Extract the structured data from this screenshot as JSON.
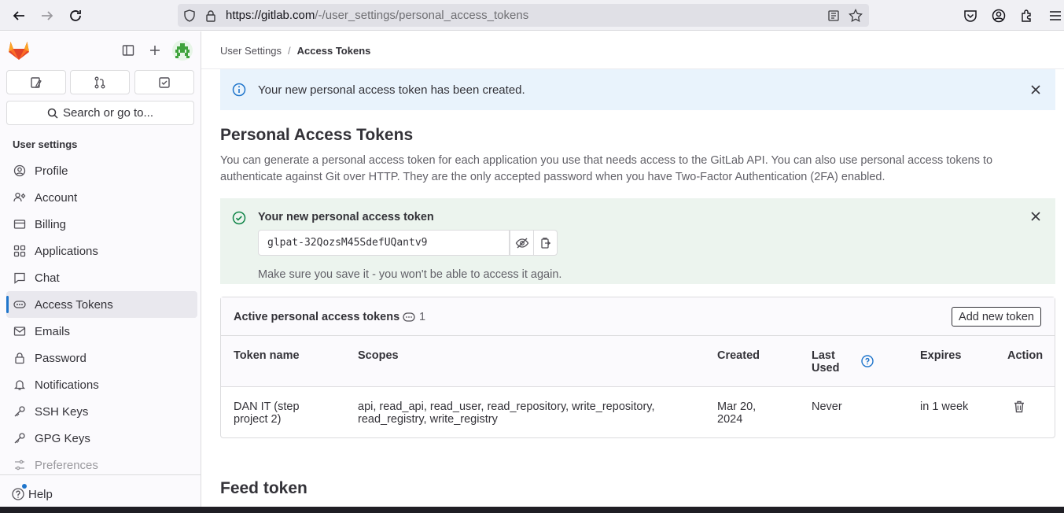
{
  "browser": {
    "url_host": "https://gitlab.com",
    "url_path": "/-/user_settings/personal_access_tokens"
  },
  "sidebar": {
    "search_label": "Search or go to...",
    "heading": "User settings",
    "items": [
      {
        "label": "Profile"
      },
      {
        "label": "Account"
      },
      {
        "label": "Billing"
      },
      {
        "label": "Applications"
      },
      {
        "label": "Chat"
      },
      {
        "label": "Access Tokens"
      },
      {
        "label": "Emails"
      },
      {
        "label": "Password"
      },
      {
        "label": "Notifications"
      },
      {
        "label": "SSH Keys"
      },
      {
        "label": "GPG Keys"
      },
      {
        "label": "Preferences"
      }
    ],
    "help_label": "Help"
  },
  "breadcrumb": {
    "parent": "User Settings",
    "separator": "/",
    "current": "Access Tokens"
  },
  "info_alert": {
    "text": "Your new personal access token has been created."
  },
  "page": {
    "title": "Personal Access Tokens",
    "description": "You can generate a personal access token for each application you use that needs access to the GitLab API. You can also use personal access tokens to authenticate against Git over HTTP. They are the only accepted password when you have Two-Factor Authentication (2FA) enabled."
  },
  "new_token": {
    "title": "Your new personal access token",
    "value": "glpat-32QozsM45SdefUQantv9",
    "note": "Make sure you save it - you won't be able to access it again."
  },
  "active_tokens": {
    "title": "Active personal access tokens",
    "count": "1",
    "add_button": "Add new token",
    "headers": {
      "name": "Token name",
      "scopes": "Scopes",
      "created": "Created",
      "last_used_1": "Last",
      "last_used_2": "Used",
      "expires": "Expires",
      "action": "Action"
    },
    "rows": [
      {
        "name_1": "DAN IT (step",
        "name_2": "project 2)",
        "scopes_1": "api, read_api, read_user, read_repository, write_repository,",
        "scopes_2": "read_registry, write_registry",
        "created_1": "Mar 20,",
        "created_2": "2024",
        "last_used": "Never",
        "expires": "in 1 week"
      }
    ]
  },
  "feed": {
    "title": "Feed token"
  },
  "colors": {
    "info_bg": "#e9f3fc",
    "success_bg": "#ecf4ee",
    "success_icon": "#108548",
    "info_icon": "#1f75cb",
    "active_indicator": "#1f75cb"
  }
}
